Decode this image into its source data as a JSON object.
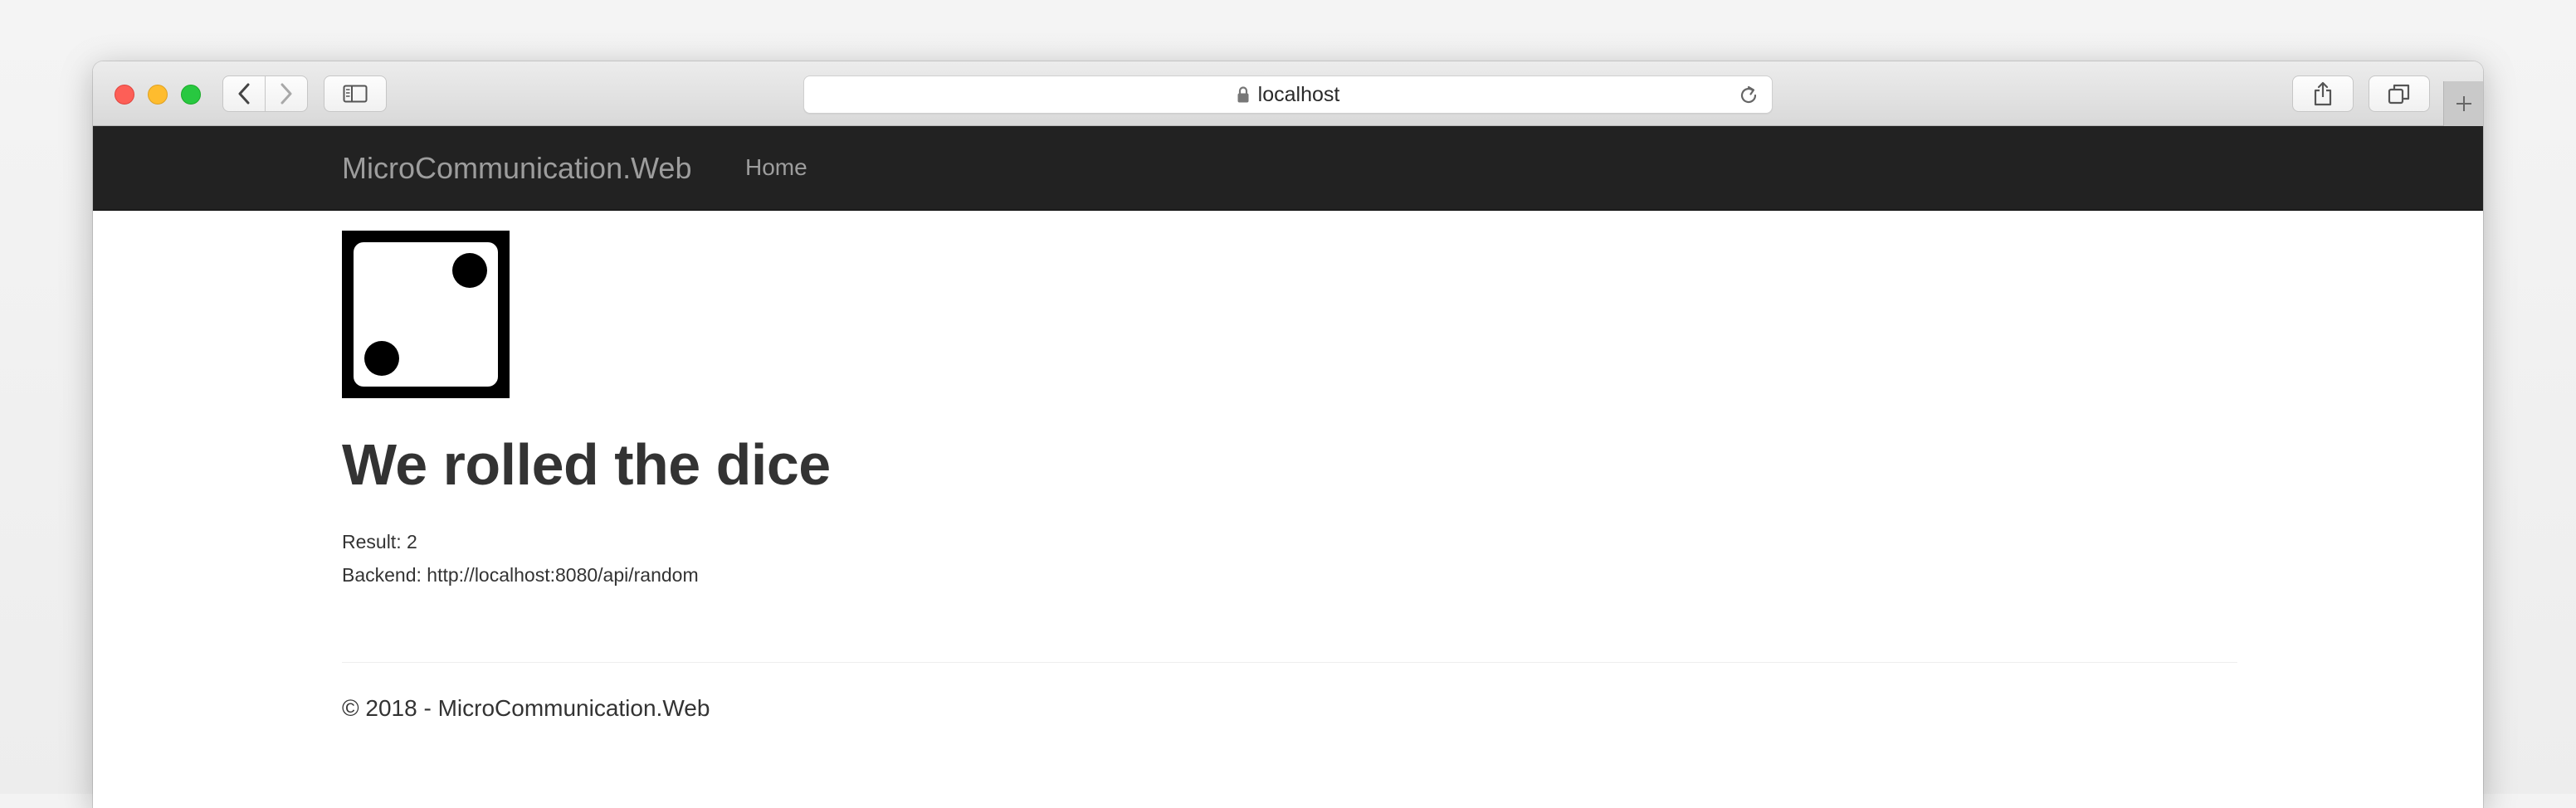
{
  "browser": {
    "url": "localhost",
    "icons": {
      "back": "chevron-left-icon",
      "forward": "chevron-right-icon",
      "sidebar": "sidebar-icon",
      "lock": "lock-icon",
      "reload": "reload-icon",
      "share": "share-icon",
      "tabs": "tabs-overview-icon",
      "new_tab": "plus-icon"
    }
  },
  "navbar": {
    "brand": "MicroCommunication.Web",
    "links": [
      "Home"
    ],
    "background": "#222222",
    "text_color": "#9d9d9d"
  },
  "main": {
    "dice_face": 2,
    "heading": "We rolled the dice",
    "result_label": "Result:",
    "result_value": "2",
    "result_text": "Result: 2",
    "backend_text": "Backend: http://localhost:8080/api/random"
  },
  "footer": {
    "text": "© 2018 - MicroCommunication.Web"
  }
}
